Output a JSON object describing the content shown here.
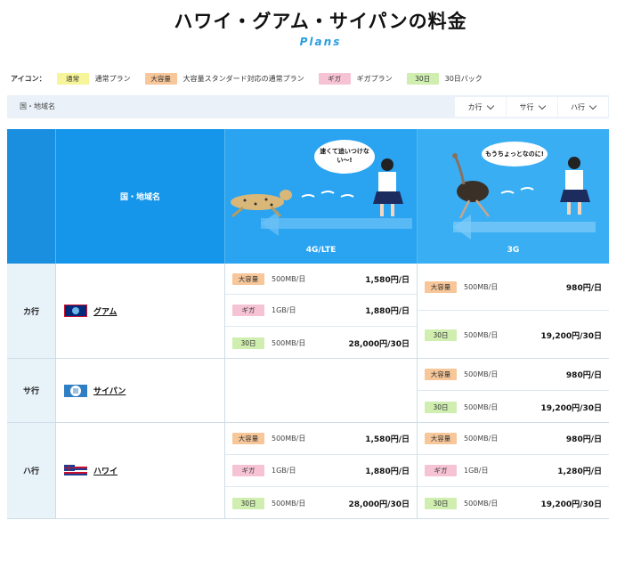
{
  "page": {
    "title": "ハワイ・グアム・サイパンの料金",
    "subtitle": "Plans"
  },
  "legend": {
    "label": "アイコン：",
    "items": [
      {
        "tag": "通常",
        "text": "通常プラン"
      },
      {
        "tag": "大容量",
        "text": "大容量スタンダード対応の通常プラン"
      },
      {
        "tag": "ギガ",
        "text": "ギガプラン"
      },
      {
        "tag": "30日",
        "text": "30日パック"
      }
    ]
  },
  "filter": {
    "label": "国・地域名",
    "dropdowns": [
      "カ行",
      "サ行",
      "ハ行"
    ]
  },
  "table_header": {
    "region": "国・地域名",
    "lte": "4G/LTE",
    "g3": "3G",
    "lte_speech": "速くて追いつけない〜!",
    "g3_speech": "もうちょっとなのに!"
  },
  "rows": [
    {
      "gyo": "カ行",
      "region": "グアム",
      "lte": [
        {
          "tag": "大容量",
          "qty": "500MB/日",
          "price": "1,580円/日"
        },
        {
          "tag": "ギガ",
          "qty": "1GB/日",
          "price": "1,880円/日"
        },
        {
          "tag": "30日",
          "qty": "500MB/日",
          "price": "28,000円/30日"
        }
      ],
      "g3": [
        {
          "tag": "大容量",
          "qty": "500MB/日",
          "price": "980円/日"
        },
        {
          "tag": "30日",
          "qty": "500MB/日",
          "price": "19,200円/30日"
        }
      ]
    },
    {
      "gyo": "サ行",
      "region": "サイパン",
      "lte": [],
      "g3": [
        {
          "tag": "大容量",
          "qty": "500MB/日",
          "price": "980円/日"
        },
        {
          "tag": "30日",
          "qty": "500MB/日",
          "price": "19,200円/30日"
        }
      ]
    },
    {
      "gyo": "ハ行",
      "region": "ハワイ",
      "lte": [
        {
          "tag": "大容量",
          "qty": "500MB/日",
          "price": "1,580円/日"
        },
        {
          "tag": "ギガ",
          "qty": "1GB/日",
          "price": "1,880円/日"
        },
        {
          "tag": "30日",
          "qty": "500MB/日",
          "price": "28,000円/30日"
        }
      ],
      "g3": [
        {
          "tag": "大容量",
          "qty": "500MB/日",
          "price": "980円/日"
        },
        {
          "tag": "ギガ",
          "qty": "1GB/日",
          "price": "1,280円/日"
        },
        {
          "tag": "30日",
          "qty": "500MB/日",
          "price": "19,200円/30日"
        }
      ]
    }
  ],
  "colors": {
    "accent": "#2a9de0",
    "header_blue": "#1596ea",
    "tag_normal": "#f7f59a",
    "tag_large": "#f7c79a",
    "tag_giga": "#f6c3d5",
    "tag_30": "#cfeeb0"
  }
}
